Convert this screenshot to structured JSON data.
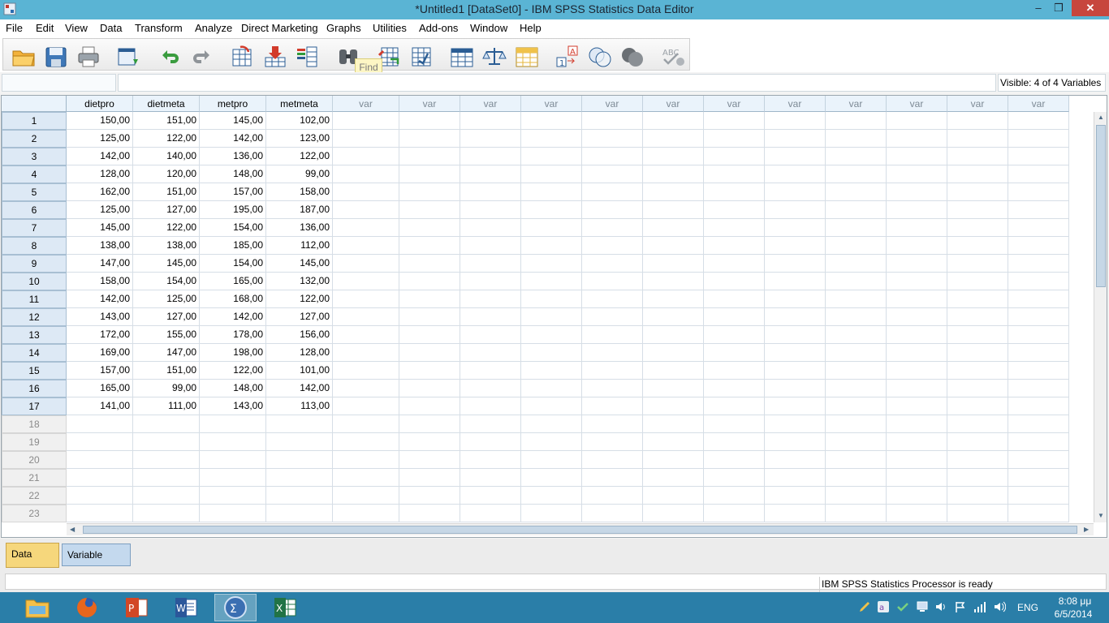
{
  "window": {
    "title": "*Untitled1 [DataSet0] - IBM SPSS Statistics Data Editor",
    "minimize": "–",
    "maximize": "❒",
    "close": "✕"
  },
  "menu": [
    "File",
    "Edit",
    "View",
    "Data",
    "Transform",
    "Analyze",
    "Direct Marketing",
    "Graphs",
    "Utilities",
    "Add-ons",
    "Window",
    "Help"
  ],
  "toolbar": {
    "icons": [
      "open-folder-icon",
      "save-icon",
      "print-icon",
      "recall-dialog-icon",
      "undo-icon",
      "redo-icon",
      "goto-case-icon",
      "goto-variable-icon",
      "variables-icon",
      "find-icon",
      "insert-cases-icon",
      "insert-variable-icon",
      "split-file-icon",
      "weight-cases-icon",
      "select-cases-icon",
      "value-labels-icon",
      "use-sets-icon",
      "show-all-variables-icon",
      "spell-check-icon"
    ],
    "tooltip": "Find"
  },
  "cellbar": {
    "cell_ref": "",
    "cell_value": "",
    "visible": "Visible: 4 of 4 Variables"
  },
  "grid": {
    "columns": [
      "dietpro",
      "dietmeta",
      "metpro",
      "metmeta",
      "var",
      "var",
      "var",
      "var",
      "var",
      "var",
      "var",
      "var",
      "var",
      "var",
      "var",
      "var"
    ],
    "row_numbers": [
      "1",
      "2",
      "3",
      "4",
      "5",
      "6",
      "7",
      "8",
      "9",
      "10",
      "11",
      "12",
      "13",
      "14",
      "15",
      "16",
      "17",
      "18",
      "19",
      "20",
      "21",
      "22",
      "23"
    ],
    "rows": [
      [
        "150,00",
        "151,00",
        "145,00",
        "102,00"
      ],
      [
        "125,00",
        "122,00",
        "142,00",
        "123,00"
      ],
      [
        "142,00",
        "140,00",
        "136,00",
        "122,00"
      ],
      [
        "128,00",
        "120,00",
        "148,00",
        "99,00"
      ],
      [
        "162,00",
        "151,00",
        "157,00",
        "158,00"
      ],
      [
        "125,00",
        "127,00",
        "195,00",
        "187,00"
      ],
      [
        "145,00",
        "122,00",
        "154,00",
        "136,00"
      ],
      [
        "138,00",
        "138,00",
        "185,00",
        "112,00"
      ],
      [
        "147,00",
        "145,00",
        "154,00",
        "145,00"
      ],
      [
        "158,00",
        "154,00",
        "165,00",
        "132,00"
      ],
      [
        "142,00",
        "125,00",
        "168,00",
        "122,00"
      ],
      [
        "143,00",
        "127,00",
        "142,00",
        "127,00"
      ],
      [
        "172,00",
        "155,00",
        "178,00",
        "156,00"
      ],
      [
        "169,00",
        "147,00",
        "198,00",
        "128,00"
      ],
      [
        "157,00",
        "151,00",
        "122,00",
        "101,00"
      ],
      [
        "165,00",
        "99,00",
        "148,00",
        "142,00"
      ],
      [
        "141,00",
        "111,00",
        "143,00",
        "113,00"
      ]
    ]
  },
  "tabs": {
    "data_view": "Data View",
    "variable_view": "Variable View"
  },
  "status": {
    "processor": "IBM SPSS Statistics Processor is ready"
  },
  "taskbar": {
    "apps": [
      "file-explorer-icon",
      "firefox-icon",
      "powerpoint-icon",
      "word-icon",
      "spss-icon",
      "excel-icon"
    ],
    "language": "ENG",
    "time": "8:08 μμ",
    "date": "6/5/2014"
  }
}
